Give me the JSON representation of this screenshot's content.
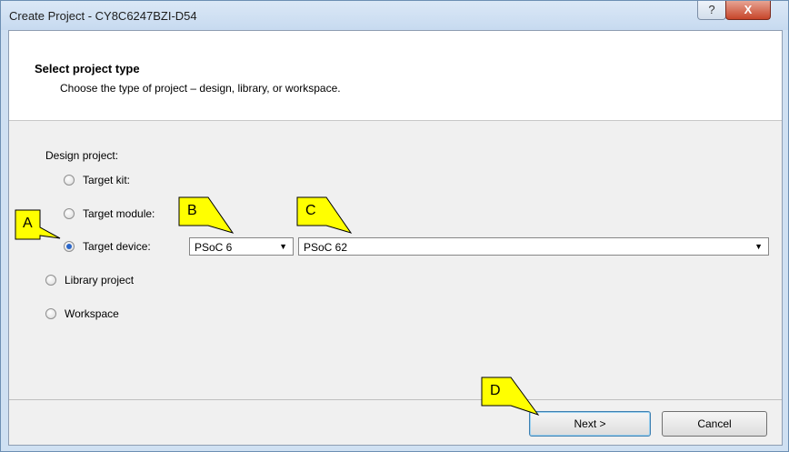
{
  "window": {
    "title": "Create Project - CY8C6247BZI-D54",
    "help_label": "?",
    "close_label": "X"
  },
  "header": {
    "title": "Select project type",
    "subtitle": "Choose the type of project – design, library, or workspace."
  },
  "design": {
    "group_label": "Design project:",
    "target_kit": {
      "label": "Target kit:",
      "checked": false
    },
    "target_module": {
      "label": "Target module:",
      "checked": false
    },
    "target_device": {
      "label": "Target device:",
      "checked": true
    }
  },
  "library_project": {
    "label": "Library project",
    "checked": false
  },
  "workspace": {
    "label": "Workspace",
    "checked": false
  },
  "family_dropdown": {
    "value": "PSoC 6"
  },
  "series_dropdown": {
    "value": "PSoC 62"
  },
  "buttons": {
    "next": "Next >",
    "cancel": "Cancel"
  },
  "callouts": {
    "a": "A",
    "b": "B",
    "c": "C",
    "d": "D",
    "color": "#ffff00"
  }
}
